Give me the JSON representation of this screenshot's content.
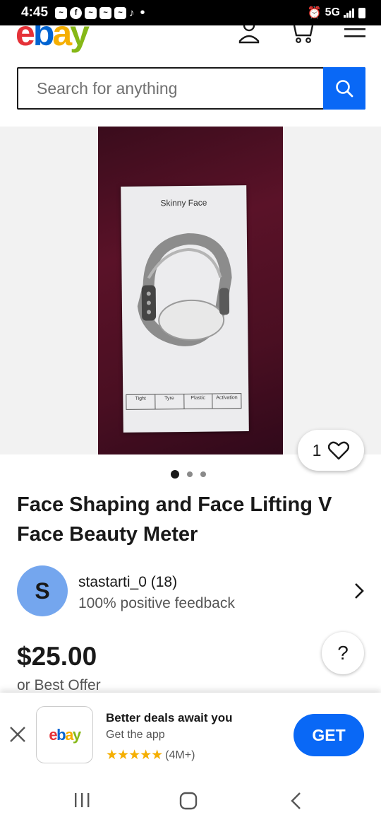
{
  "status_bar": {
    "time": "4:45",
    "dot": "•",
    "network": "5G",
    "icons": [
      "notification-icon",
      "facebook-icon",
      "notification-icon",
      "notification-icon",
      "notification-icon",
      "tiktok-icon",
      "alarm-icon",
      "signal-icon",
      "battery-icon"
    ]
  },
  "header": {
    "logo_letters": [
      "e",
      "b",
      "a",
      "y"
    ],
    "brand_colors": {
      "red": "#e53238",
      "blue": "#0064d2",
      "yellow": "#f5af02",
      "green": "#86b817"
    },
    "icons": [
      "account-icon",
      "cart-icon",
      "menu-icon"
    ]
  },
  "search": {
    "placeholder": "Search for anything",
    "button_color": "#0968f6"
  },
  "product_photo": {
    "box_title": "Skinny Face",
    "box_labels": [
      "Tight",
      "Tyre",
      "Plastic",
      "Activation"
    ]
  },
  "gallery": {
    "like_count": "1",
    "dots": 3,
    "active_dot": 0
  },
  "listing": {
    "title": "Face Shaping and Face Lifting V Face Beauty Meter",
    "price": "$25.00",
    "best_offer": "or Best Offer",
    "help_label": "?"
  },
  "seller": {
    "avatar_letter": "S",
    "name": "stastarti_0 (18)",
    "feedback": "100% positive feedback"
  },
  "app_banner": {
    "headline": "Better deals await you",
    "subtitle": "Get the app",
    "stars": "★★★★★",
    "rating_count": "(4M+)",
    "get_label": "GET"
  }
}
